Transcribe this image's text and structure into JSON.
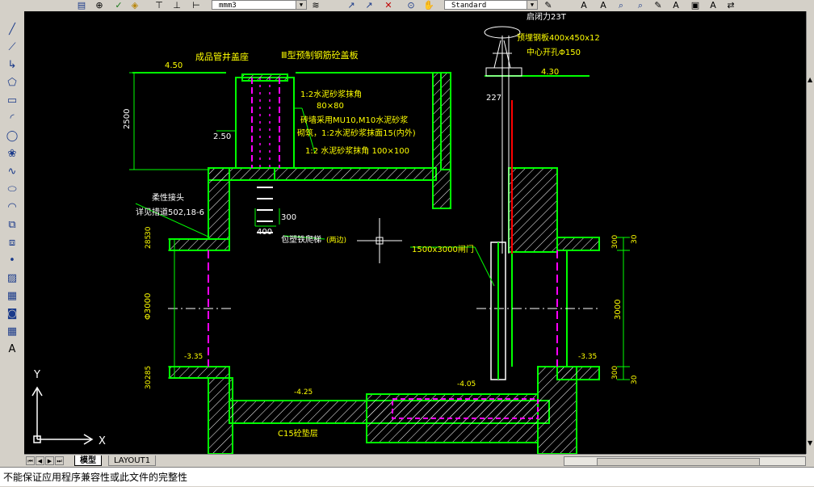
{
  "toolbar": {
    "layer_combo": "mmm3",
    "style_combo": "Standard"
  },
  "drawing": {
    "labels": {
      "lid_label": "成品管井盖座",
      "slab_label": "Ⅲ型预制钢筋砼盖板",
      "el_450_left": "4.50",
      "el_450_right": "4.30",
      "dim_2500": "2500",
      "el_250": "2.50",
      "mortar_fillet": "1:2水泥砂浆抹角",
      "fillet_size": "80×80",
      "brick_wall": "砖墙采用MU10,M10水泥砂浆",
      "plaster": "砌筑，1:2水泥砂浆抹面15(内外)",
      "fillet_100": "1:2 水泥砂浆抹角 100×100",
      "hoist": "启闭力23T",
      "steel_plate": "预埋钢板400x450x12",
      "center_hole": "中心开孔Φ150",
      "dim_227": "227",
      "flexible_joint": "柔性接头",
      "flexible_joint_ref": "详见措道502,18-6",
      "dim_300": "300",
      "dim_400": "400",
      "ladder": "包塑铁爬梯",
      "ladder_note": "(两边)",
      "gate": "1500x3000闸门",
      "dim_285_top": "285",
      "dim_30_top": "30",
      "dia_3000": "Φ3000",
      "dim_285_bot": "285",
      "dim_30_bot": "30",
      "el_335_left": "-3.35",
      "el_335_right": "-3.35",
      "dim_300_right_top": "300",
      "dim_30_right_top": "30",
      "dim_3000_right": "3000",
      "dim_300_right_bot": "300",
      "dim_30_right_bot": "30",
      "el_405": "-4.05",
      "el_425": "-4.25",
      "cushion": "C15砼垫层",
      "axis_y": "Y",
      "axis_x": "X"
    }
  },
  "tabs": {
    "model": "模型",
    "layout": "LAYOUT1"
  },
  "command": {
    "text": "不能保证应用程序兼容性或此文件的完整性"
  },
  "colors": {
    "canvas_bg": "#000000",
    "structure": "#00ff00",
    "text_label": "#ffff00",
    "centerline": "#ff00ff",
    "white": "#ffffff",
    "red": "#ff0000"
  }
}
